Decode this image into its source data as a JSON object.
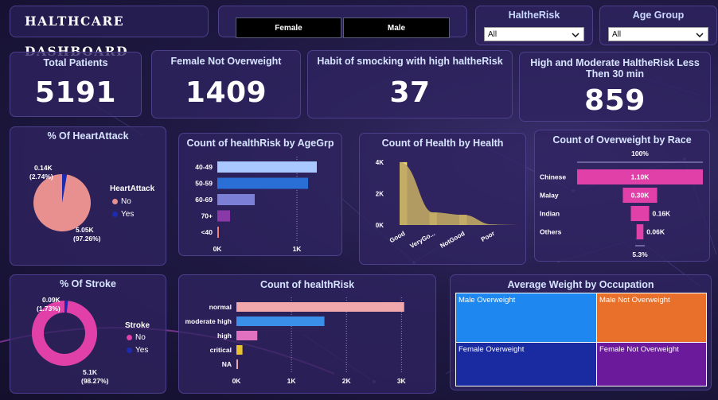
{
  "header": {
    "title": "HALTHCARE DASHBOARD"
  },
  "gender_toggle": {
    "options": [
      "Female",
      "Male"
    ]
  },
  "filters": [
    {
      "title": "HaltheRisk",
      "value": "All"
    },
    {
      "title": "Age Group",
      "value": "All"
    }
  ],
  "kpis": [
    {
      "title": "Total Patients",
      "value": "5191"
    },
    {
      "title": "Female Not Overweight",
      "value": "1409"
    },
    {
      "title": "Habit of smocking with high haltheRisk",
      "value": "37"
    },
    {
      "title": "High and Moderate HaltheRisk Less Then 30 min",
      "value": "859"
    }
  ],
  "heart_attack": {
    "title": "% Of HeartAttack",
    "legend_title": "HeartAttack",
    "legend": [
      "No",
      "Yes"
    ],
    "colors": {
      "No": "#e8908f",
      "Yes": "#1c2bb0"
    },
    "label_yes_count": "0.14K",
    "label_yes_pct": "(2.74%)",
    "label_no_count": "5.05K",
    "label_no_pct": "(97.26%)",
    "chart_data": {
      "type": "pie",
      "categories": [
        "No",
        "Yes"
      ],
      "values": [
        97.26,
        2.74
      ]
    }
  },
  "age_group": {
    "title": "Count of healthRisk by AgeGrp",
    "color_note": "bars colored per category",
    "colors": [
      "#a9c8ff",
      "#2a6fd6",
      "#7b7fd6",
      "#8a3aa8",
      "#f08080"
    ],
    "ticks": [
      "0K",
      "1K"
    ],
    "chart_data": {
      "type": "bar",
      "orientation": "horizontal",
      "categories": [
        "40-49",
        "50-59",
        "60-69",
        "70+",
        "<40"
      ],
      "values": [
        1250,
        1140,
        470,
        160,
        20
      ],
      "xlim": [
        0,
        1500
      ]
    }
  },
  "health": {
    "title": "Count of Health by Health",
    "yticks": [
      "4K",
      "2K",
      "0K"
    ],
    "categories": [
      "Good",
      "VeryGo...",
      "NotGood",
      "Poor"
    ],
    "colors": {
      "fill": "#e8d27a",
      "fill_dark": "#a68f55"
    },
    "chart_data": {
      "type": "area",
      "categories": [
        "Good",
        "VeryGood",
        "NotGood",
        "Poor"
      ],
      "values": [
        4000,
        800,
        650,
        30
      ],
      "ylim": [
        0,
        4300
      ]
    }
  },
  "race": {
    "title": "Count of Overweight by Race",
    "top_pct": "100%",
    "bottom_pct": "5.3%",
    "color": "#e040a8",
    "labels": [
      "1.10K",
      "0.30K",
      "0.16K",
      "0.06K"
    ],
    "chart_data": {
      "type": "bar",
      "subtype": "funnel",
      "categories": [
        "Chinese",
        "Malay",
        "Indian",
        "Others"
      ],
      "values": [
        1100,
        300,
        160,
        60
      ]
    }
  },
  "stroke": {
    "title": "% Of Stroke",
    "legend_title": "Stroke",
    "legend": [
      "No",
      "Yes"
    ],
    "colors": {
      "No": "#e040a8",
      "Yes": "#1c2bb0"
    },
    "label_yes_count": "0.09K",
    "label_yes_pct": "(1.73%)",
    "label_no_count": "5.1K",
    "label_no_pct": "(98.27%)",
    "chart_data": {
      "type": "pie",
      "subtype": "donut",
      "categories": [
        "No",
        "Yes"
      ],
      "values": [
        98.27,
        1.73
      ]
    }
  },
  "health_risk": {
    "title": "Count of healthRisk",
    "colors": [
      "#f0a8ac",
      "#3a8fe8",
      "#e070c0",
      "#e8c030",
      "#e8a8b0"
    ],
    "ticks": [
      "0K",
      "1K",
      "2K",
      "3K"
    ],
    "chart_data": {
      "type": "bar",
      "orientation": "horizontal",
      "categories": [
        "normal",
        "moderate high",
        "high",
        "critical",
        "NA"
      ],
      "values": [
        3050,
        1600,
        380,
        110,
        20
      ],
      "xlim": [
        0,
        3300
      ]
    }
  },
  "occupation": {
    "title": "Average Weight by Occupation",
    "tiles": [
      {
        "label": "Male Overweight",
        "color": "#1e88f0"
      },
      {
        "label": "Male Not Overweight",
        "color": "#e8702a"
      },
      {
        "label": "Female Overweight",
        "color": "#1a2aa0"
      },
      {
        "label": "Female Not Overweight",
        "color": "#6a1a9a"
      }
    ]
  }
}
